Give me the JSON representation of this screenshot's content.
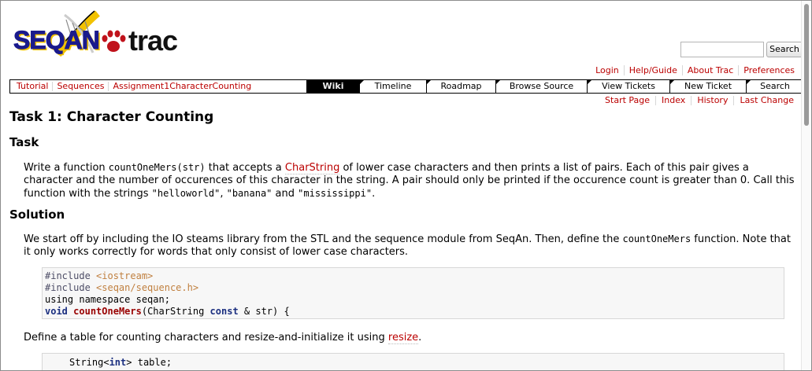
{
  "logo": {
    "seqan": "SEQAN",
    "trac": "trac"
  },
  "search": {
    "placeholder": "",
    "button_label": "Search"
  },
  "metanav": [
    "Login",
    "Help/Guide",
    "About Trac",
    "Preferences"
  ],
  "breadcrumbs": [
    "Tutorial",
    "Sequences",
    "Assignment1CharacterCounting"
  ],
  "mainnav": {
    "tabs": [
      {
        "label": "Wiki",
        "active": true
      },
      {
        "label": "Timeline",
        "active": false
      },
      {
        "label": "Roadmap",
        "active": false
      },
      {
        "label": "Browse Source",
        "active": false
      },
      {
        "label": "View Tickets",
        "active": false
      },
      {
        "label": "New Ticket",
        "active": false
      },
      {
        "label": "Search",
        "active": false
      }
    ]
  },
  "ctxtnav": [
    "Start Page",
    "Index",
    "History",
    "Last Change"
  ],
  "page": {
    "title": "Task 1: Character Counting",
    "task_heading": "Task",
    "task_text": {
      "a": "Write a function ",
      "code1": "countOneMers(str)",
      "b": " that accepts a ",
      "link1": "CharString",
      "c": " of lower case characters and then prints a list of pairs. Each of this pair gives a character and the number of occurences of this character in the string. A pair should only be printed if the occurence count is greater than 0. Call this function with the strings ",
      "s1": "\"helloworld\"",
      "d": ", ",
      "s2": "\"banana\"",
      "e": " and ",
      "s3": "\"mississippi\"",
      "f": "."
    },
    "solution_heading": "Solution",
    "solution_text": {
      "a": "We start off by including the IO steams library from the STL and the sequence module from SeqAn. Then, define the ",
      "code1": "countOneMers",
      "b": " function. Note that it only works correctly for words that only consist of lower case characters."
    },
    "code_block_1": {
      "line1_pre": "#include",
      "line1_file": "<iostream>",
      "line2_pre": "#include",
      "line2_file": "<seqan/sequence.h>",
      "line3": "using namespace seqan;",
      "line4_kw": "void",
      "line4_fn": "countOneMers",
      "line4_a": "(CharString ",
      "line4_kw2": "const",
      "line4_b": " & str) {"
    },
    "define_text": {
      "a": "Define a table for counting characters and resize-and-initialize it using ",
      "link1": "resize",
      "b": "."
    },
    "code_block_2": {
      "a": "String<",
      "kw": "int",
      "b": "> table;"
    }
  }
}
